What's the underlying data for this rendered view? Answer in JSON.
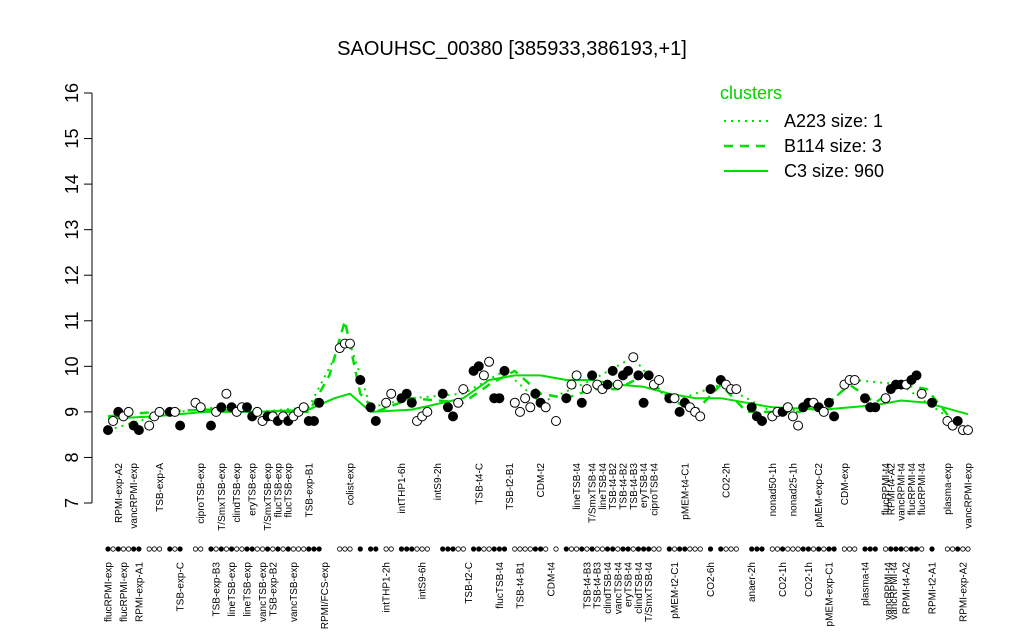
{
  "chart_data": {
    "type": "line",
    "title": "SAOUHSC_00380 [385933,386193,+1]",
    "xlabel": "",
    "ylabel": "",
    "ylim": [
      7,
      16
    ],
    "yticks": [
      7,
      8,
      9,
      10,
      11,
      12,
      13,
      14,
      15,
      16
    ],
    "grid": false,
    "legend": {
      "title": "clusters",
      "position": "top-right",
      "entries": [
        {
          "label": "A223 size: 1",
          "style": "dotted"
        },
        {
          "label": "B114 size: 3",
          "style": "dashed"
        },
        {
          "label": "C3 size: 960",
          "style": "solid"
        }
      ]
    },
    "colors": {
      "line": "#00dd00",
      "points_fill": "#000000",
      "points_open": "#ffffff"
    },
    "x_tick_labels": [
      {
        "x": 1,
        "label": "flucRPMI-exp",
        "row": "bottom"
      },
      {
        "x": 3,
        "label": "RPMI-exp-A2",
        "row": "top"
      },
      {
        "x": 4,
        "label": "flucRPMI-exp",
        "row": "bottom"
      },
      {
        "x": 6,
        "label": "vancRPMI-exp",
        "row": "top"
      },
      {
        "x": 7,
        "label": "RPMI-exp-A1",
        "row": "bottom"
      },
      {
        "x": 11,
        "label": "TSB-exp-A",
        "row": "top"
      },
      {
        "x": 15,
        "label": "TSB-exp-C",
        "row": "bottom"
      },
      {
        "x": 19,
        "label": "ciproTSB-exp",
        "row": "top"
      },
      {
        "x": 22,
        "label": "TSB-exp-B3",
        "row": "bottom"
      },
      {
        "x": 23,
        "label": "T/SmxTSB-exp",
        "row": "top"
      },
      {
        "x": 25,
        "label": "lineTSB-exp",
        "row": "bottom"
      },
      {
        "x": 26,
        "label": "clindTSB-exp",
        "row": "top"
      },
      {
        "x": 28,
        "label": "lineTSB-exp",
        "row": "bottom"
      },
      {
        "x": 29,
        "label": "eryTSB-exp",
        "row": "top"
      },
      {
        "x": 31,
        "label": "vancTSB-exp",
        "row": "bottom"
      },
      {
        "x": 32,
        "label": "T/SmxTSB-exp",
        "row": "top"
      },
      {
        "x": 33,
        "label": "TSB-exp-B2",
        "row": "bottom"
      },
      {
        "x": 34,
        "label": "flucTSB-exp",
        "row": "top"
      },
      {
        "x": 36,
        "label": "flucTSB-exp",
        "row": "top"
      },
      {
        "x": 37,
        "label": "vancTSB-exp",
        "row": "bottom"
      },
      {
        "x": 40,
        "label": "TSB-exp-B1",
        "row": "top"
      },
      {
        "x": 43,
        "label": "RPMI/FCS-exp",
        "row": "bottom"
      },
      {
        "x": 48,
        "label": "colist-exp",
        "row": "top"
      },
      {
        "x": 55,
        "label": "intTHP1-2h",
        "row": "bottom"
      },
      {
        "x": 58,
        "label": "intTHP1-6h",
        "row": "top"
      },
      {
        "x": 62,
        "label": "intS9-6h",
        "row": "bottom"
      },
      {
        "x": 65,
        "label": "intS9-2h",
        "row": "top"
      },
      {
        "x": 71,
        "label": "TSB-t2-C",
        "row": "bottom"
      },
      {
        "x": 73,
        "label": "TSB-t4-C",
        "row": "top"
      },
      {
        "x": 77,
        "label": "flucTSB-t4",
        "row": "bottom"
      },
      {
        "x": 79,
        "label": "TSB-t2-B1",
        "row": "top"
      },
      {
        "x": 81,
        "label": "TSB-t4-B1",
        "row": "bottom"
      },
      {
        "x": 85,
        "label": "CDM-t2",
        "row": "top"
      },
      {
        "x": 87,
        "label": "CDM-t4",
        "row": "bottom"
      },
      {
        "x": 92,
        "label": "lineTSB-t4",
        "row": "top"
      },
      {
        "x": 94,
        "label": "TSB-t4-B3",
        "row": "bottom"
      },
      {
        "x": 95,
        "label": "T/SmxTSB-t4",
        "row": "top"
      },
      {
        "x": 96,
        "label": "TSB-t4-B3",
        "row": "bottom"
      },
      {
        "x": 97,
        "label": "lineTSB-t4",
        "row": "top"
      },
      {
        "x": 98,
        "label": "clindTSB-t4",
        "row": "bottom"
      },
      {
        "x": 99,
        "label": "TSB-t4-B2",
        "row": "top"
      },
      {
        "x": 100,
        "label": "vancTSB-t4",
        "row": "bottom"
      },
      {
        "x": 101,
        "label": "TSB-t4-B2",
        "row": "top"
      },
      {
        "x": 102,
        "label": "eryTSB-t4",
        "row": "bottom"
      },
      {
        "x": 103,
        "label": "TSB-t4-B3",
        "row": "top"
      },
      {
        "x": 104,
        "label": "clindTSB-t4",
        "row": "bottom"
      },
      {
        "x": 105,
        "label": "eryTSB-t4",
        "row": "top"
      },
      {
        "x": 106,
        "label": "T/SmxTSB-t4",
        "row": "bottom"
      },
      {
        "x": 107,
        "label": "ciproTSB-t4",
        "row": "top"
      },
      {
        "x": 111,
        "label": "pMEM-t2-C1",
        "row": "bottom"
      },
      {
        "x": 113,
        "label": "pMEM-t4-C1",
        "row": "top"
      },
      {
        "x": 118,
        "label": "CO2-6h",
        "row": "bottom"
      },
      {
        "x": 121,
        "label": "CO2-2h",
        "row": "top"
      },
      {
        "x": 126,
        "label": "anaer-2h",
        "row": "bottom"
      },
      {
        "x": 130,
        "label": "nonad50-1h",
        "row": "top"
      },
      {
        "x": 132,
        "label": "CO2-1h",
        "row": "bottom"
      },
      {
        "x": 134,
        "label": "nonad25-1h",
        "row": "top"
      },
      {
        "x": 137,
        "label": "CO2-1h",
        "row": "bottom"
      },
      {
        "x": 139,
        "label": "pMEM-exp-C2",
        "row": "top"
      },
      {
        "x": 141,
        "label": "pMEM-exp-C1",
        "row": "bottom"
      },
      {
        "x": 144,
        "label": "CDM-exp",
        "row": "top"
      },
      {
        "x": 148,
        "label": "plasma-t4",
        "row": "bottom"
      },
      {
        "x": 152,
        "label": "flucRPMI-t4",
        "row": "top"
      },
      {
        "x": 152.5,
        "label": "vancRPMI-t4",
        "row": "bottom"
      },
      {
        "x": 153,
        "label": "RPMI-t4-A2",
        "row": "top"
      },
      {
        "x": 153.5,
        "label": "vancRPMI-t4",
        "row": "bottom"
      },
      {
        "x": 155,
        "label": "vancRPMI-t4",
        "row": "top"
      },
      {
        "x": 156,
        "label": "RPMI-t4-A2",
        "row": "bottom"
      },
      {
        "x": 157,
        "label": "flucRPMI-t4",
        "row": "top"
      },
      {
        "x": 159,
        "label": "flucRPMI-t4",
        "row": "top"
      },
      {
        "x": 161,
        "label": "RPMI-t2-A1",
        "row": "bottom"
      },
      {
        "x": 164,
        "label": "plasma-exp",
        "row": "top"
      },
      {
        "x": 167,
        "label": "RPMI-exp-A2",
        "row": "bottom"
      },
      {
        "x": 168,
        "label": "vancRPMI-exp",
        "row": "top"
      }
    ],
    "points": [
      {
        "x": 1,
        "y": 8.6,
        "f": 1
      },
      {
        "x": 2,
        "y": 8.8,
        "f": 0
      },
      {
        "x": 3,
        "y": 9.0,
        "f": 1
      },
      {
        "x": 4,
        "y": 8.9,
        "f": 0
      },
      {
        "x": 5,
        "y": 9.0,
        "f": 0
      },
      {
        "x": 6,
        "y": 8.7,
        "f": 1
      },
      {
        "x": 7,
        "y": 8.6,
        "f": 1
      },
      {
        "x": 9,
        "y": 8.7,
        "f": 0
      },
      {
        "x": 10,
        "y": 8.9,
        "f": 0
      },
      {
        "x": 11,
        "y": 9.0,
        "f": 0
      },
      {
        "x": 13,
        "y": 9.0,
        "f": 1
      },
      {
        "x": 14,
        "y": 9.0,
        "f": 0
      },
      {
        "x": 15,
        "y": 8.7,
        "f": 1
      },
      {
        "x": 18,
        "y": 9.2,
        "f": 0
      },
      {
        "x": 19,
        "y": 9.1,
        "f": 0
      },
      {
        "x": 21,
        "y": 8.7,
        "f": 1
      },
      {
        "x": 22,
        "y": 9.0,
        "f": 0
      },
      {
        "x": 23,
        "y": 9.1,
        "f": 1
      },
      {
        "x": 24,
        "y": 9.4,
        "f": 0
      },
      {
        "x": 25,
        "y": 9.1,
        "f": 1
      },
      {
        "x": 26,
        "y": 9.0,
        "f": 0
      },
      {
        "x": 27,
        "y": 9.1,
        "f": 0
      },
      {
        "x": 28,
        "y": 9.1,
        "f": 1
      },
      {
        "x": 29,
        "y": 8.9,
        "f": 1
      },
      {
        "x": 30,
        "y": 9.0,
        "f": 0
      },
      {
        "x": 31,
        "y": 8.8,
        "f": 0
      },
      {
        "x": 32,
        "y": 8.9,
        "f": 1
      },
      {
        "x": 33,
        "y": 8.9,
        "f": 0
      },
      {
        "x": 34,
        "y": 8.8,
        "f": 1
      },
      {
        "x": 35,
        "y": 8.9,
        "f": 0
      },
      {
        "x": 36,
        "y": 8.8,
        "f": 1
      },
      {
        "x": 37,
        "y": 8.9,
        "f": 0
      },
      {
        "x": 38,
        "y": 9.0,
        "f": 0
      },
      {
        "x": 39,
        "y": 9.1,
        "f": 0
      },
      {
        "x": 40,
        "y": 8.8,
        "f": 1
      },
      {
        "x": 41,
        "y": 8.8,
        "f": 1
      },
      {
        "x": 42,
        "y": 9.2,
        "f": 1
      },
      {
        "x": 46,
        "y": 10.4,
        "f": 0
      },
      {
        "x": 47,
        "y": 10.5,
        "f": 0
      },
      {
        "x": 48,
        "y": 10.5,
        "f": 0
      },
      {
        "x": 50,
        "y": 9.7,
        "f": 1
      },
      {
        "x": 52,
        "y": 9.1,
        "f": 1
      },
      {
        "x": 53,
        "y": 8.8,
        "f": 1
      },
      {
        "x": 55,
        "y": 9.2,
        "f": 0
      },
      {
        "x": 56,
        "y": 9.4,
        "f": 0
      },
      {
        "x": 58,
        "y": 9.3,
        "f": 1
      },
      {
        "x": 59,
        "y": 9.4,
        "f": 1
      },
      {
        "x": 60,
        "y": 9.2,
        "f": 1
      },
      {
        "x": 61,
        "y": 8.8,
        "f": 0
      },
      {
        "x": 62,
        "y": 8.9,
        "f": 0
      },
      {
        "x": 63,
        "y": 9.0,
        "f": 0
      },
      {
        "x": 66,
        "y": 9.4,
        "f": 1
      },
      {
        "x": 67,
        "y": 9.1,
        "f": 1
      },
      {
        "x": 68,
        "y": 8.9,
        "f": 1
      },
      {
        "x": 69,
        "y": 9.2,
        "f": 0
      },
      {
        "x": 70,
        "y": 9.5,
        "f": 0
      },
      {
        "x": 72,
        "y": 9.9,
        "f": 1
      },
      {
        "x": 73,
        "y": 10.0,
        "f": 1
      },
      {
        "x": 74,
        "y": 9.8,
        "f": 0
      },
      {
        "x": 75,
        "y": 10.1,
        "f": 0
      },
      {
        "x": 76,
        "y": 9.3,
        "f": 1
      },
      {
        "x": 77,
        "y": 9.3,
        "f": 1
      },
      {
        "x": 78,
        "y": 9.9,
        "f": 1
      },
      {
        "x": 80,
        "y": 9.2,
        "f": 0
      },
      {
        "x": 81,
        "y": 9.0,
        "f": 0
      },
      {
        "x": 82,
        "y": 9.3,
        "f": 0
      },
      {
        "x": 83,
        "y": 9.1,
        "f": 0
      },
      {
        "x": 84,
        "y": 9.4,
        "f": 1
      },
      {
        "x": 85,
        "y": 9.2,
        "f": 1
      },
      {
        "x": 86,
        "y": 9.1,
        "f": 0
      },
      {
        "x": 88,
        "y": 8.8,
        "f": 0
      },
      {
        "x": 90,
        "y": 9.3,
        "f": 1
      },
      {
        "x": 91,
        "y": 9.6,
        "f": 0
      },
      {
        "x": 92,
        "y": 9.8,
        "f": 0
      },
      {
        "x": 93,
        "y": 9.2,
        "f": 1
      },
      {
        "x": 94,
        "y": 9.5,
        "f": 0
      },
      {
        "x": 95,
        "y": 9.8,
        "f": 1
      },
      {
        "x": 96,
        "y": 9.6,
        "f": 0
      },
      {
        "x": 97,
        "y": 9.5,
        "f": 0
      },
      {
        "x": 98,
        "y": 9.6,
        "f": 1
      },
      {
        "x": 99,
        "y": 9.9,
        "f": 1
      },
      {
        "x": 100,
        "y": 9.6,
        "f": 0
      },
      {
        "x": 101,
        "y": 9.8,
        "f": 1
      },
      {
        "x": 102,
        "y": 9.9,
        "f": 1
      },
      {
        "x": 103,
        "y": 10.2,
        "f": 0
      },
      {
        "x": 104,
        "y": 9.8,
        "f": 1
      },
      {
        "x": 105,
        "y": 9.2,
        "f": 1
      },
      {
        "x": 106,
        "y": 9.8,
        "f": 1
      },
      {
        "x": 107,
        "y": 9.6,
        "f": 0
      },
      {
        "x": 108,
        "y": 9.7,
        "f": 0
      },
      {
        "x": 110,
        "y": 9.3,
        "f": 1
      },
      {
        "x": 111,
        "y": 9.3,
        "f": 0
      },
      {
        "x": 112,
        "y": 9.0,
        "f": 1
      },
      {
        "x": 113,
        "y": 9.2,
        "f": 1
      },
      {
        "x": 114,
        "y": 9.1,
        "f": 0
      },
      {
        "x": 115,
        "y": 9.0,
        "f": 0
      },
      {
        "x": 116,
        "y": 8.9,
        "f": 0
      },
      {
        "x": 118,
        "y": 9.5,
        "f": 1
      },
      {
        "x": 120,
        "y": 9.7,
        "f": 1
      },
      {
        "x": 121,
        "y": 9.6,
        "f": 0
      },
      {
        "x": 122,
        "y": 9.5,
        "f": 0
      },
      {
        "x": 123,
        "y": 9.5,
        "f": 0
      },
      {
        "x": 126,
        "y": 9.1,
        "f": 1
      },
      {
        "x": 127,
        "y": 8.9,
        "f": 1
      },
      {
        "x": 128,
        "y": 8.8,
        "f": 1
      },
      {
        "x": 130,
        "y": 8.9,
        "f": 0
      },
      {
        "x": 131,
        "y": 9.0,
        "f": 0
      },
      {
        "x": 132,
        "y": 9.0,
        "f": 1
      },
      {
        "x": 133,
        "y": 9.1,
        "f": 0
      },
      {
        "x": 134,
        "y": 8.9,
        "f": 0
      },
      {
        "x": 135,
        "y": 8.7,
        "f": 0
      },
      {
        "x": 136,
        "y": 9.1,
        "f": 1
      },
      {
        "x": 137,
        "y": 9.2,
        "f": 1
      },
      {
        "x": 138,
        "y": 9.2,
        "f": 0
      },
      {
        "x": 139,
        "y": 9.1,
        "f": 1
      },
      {
        "x": 140,
        "y": 9.0,
        "f": 0
      },
      {
        "x": 141,
        "y": 9.2,
        "f": 1
      },
      {
        "x": 142,
        "y": 8.9,
        "f": 1
      },
      {
        "x": 144,
        "y": 9.6,
        "f": 0
      },
      {
        "x": 145,
        "y": 9.7,
        "f": 0
      },
      {
        "x": 146,
        "y": 9.7,
        "f": 0
      },
      {
        "x": 148,
        "y": 9.3,
        "f": 1
      },
      {
        "x": 149,
        "y": 9.1,
        "f": 1
      },
      {
        "x": 150,
        "y": 9.1,
        "f": 1
      },
      {
        "x": 152,
        "y": 9.3,
        "f": 0
      },
      {
        "x": 153,
        "y": 9.5,
        "f": 1
      },
      {
        "x": 154,
        "y": 9.6,
        "f": 1
      },
      {
        "x": 155,
        "y": 9.6,
        "f": 1
      },
      {
        "x": 156,
        "y": 9.6,
        "f": 0
      },
      {
        "x": 157,
        "y": 9.7,
        "f": 1
      },
      {
        "x": 158,
        "y": 9.8,
        "f": 1
      },
      {
        "x": 159,
        "y": 9.4,
        "f": 0
      },
      {
        "x": 161,
        "y": 9.2,
        "f": 1
      },
      {
        "x": 164,
        "y": 8.8,
        "f": 0
      },
      {
        "x": 165,
        "y": 8.7,
        "f": 0
      },
      {
        "x": 166,
        "y": 8.8,
        "f": 1
      },
      {
        "x": 167,
        "y": 8.6,
        "f": 0
      },
      {
        "x": 168,
        "y": 8.6,
        "f": 0
      }
    ],
    "series": [
      {
        "name": "C3 size: 960",
        "style": "solid",
        "x": [
          1,
          10,
          20,
          30,
          40,
          45,
          48,
          52,
          60,
          70,
          75,
          80,
          85,
          90,
          95,
          100,
          105,
          110,
          115,
          120,
          130,
          140,
          150,
          155,
          160,
          168
        ],
        "y": [
          8.85,
          8.9,
          9.0,
          9.0,
          9.05,
          9.3,
          9.4,
          9.0,
          9.05,
          9.3,
          9.7,
          9.8,
          9.8,
          9.7,
          9.7,
          9.6,
          9.55,
          9.4,
          9.3,
          9.3,
          9.1,
          9.05,
          9.15,
          9.25,
          9.2,
          8.95
        ]
      },
      {
        "name": "B114 size: 3",
        "style": "dashed",
        "x": [
          1,
          10,
          20,
          30,
          40,
          44,
          47,
          50,
          53,
          60,
          70,
          75,
          80,
          85,
          90,
          95,
          100,
          105,
          110,
          115,
          120,
          125,
          130,
          135,
          140,
          145,
          150,
          155,
          160,
          165,
          168
        ],
        "y": [
          8.9,
          9.0,
          9.05,
          9.0,
          9.0,
          9.8,
          11.0,
          9.4,
          9.0,
          9.3,
          9.2,
          9.6,
          9.9,
          9.4,
          9.3,
          9.5,
          9.5,
          9.8,
          9.3,
          9.0,
          9.6,
          9.0,
          9.0,
          9.0,
          9.1,
          9.6,
          9.2,
          9.6,
          9.5,
          8.8,
          8.7
        ]
      },
      {
        "name": "A223 size: 1",
        "style": "dotted",
        "x": [
          1,
          10,
          20,
          30,
          40,
          46,
          48,
          52,
          60,
          70,
          78,
          85,
          95,
          103,
          110,
          120,
          130,
          140,
          146,
          155,
          160,
          168
        ],
        "y": [
          8.6,
          8.9,
          9.1,
          9.0,
          9.1,
          10.4,
          10.5,
          9.1,
          9.3,
          9.4,
          9.9,
          9.2,
          9.7,
          10.2,
          9.2,
          9.6,
          9.0,
          9.1,
          9.7,
          9.6,
          9.2,
          8.6
        ]
      }
    ]
  }
}
